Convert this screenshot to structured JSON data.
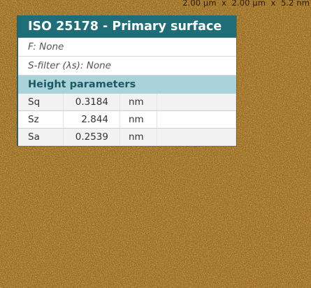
{
  "image": {
    "dimensions_label": "2.00 µm  x  2.00 µm  x  5.2 nm"
  },
  "panel": {
    "title": "ISO 25178 - Primary surface",
    "filter_f": "F: None",
    "filter_s": "S-filter (λs): None",
    "section_title": "Height parameters",
    "rows": [
      {
        "name": "Sq",
        "value": "0.3184",
        "unit": "nm"
      },
      {
        "name": "Sz",
        "value": "2.844",
        "unit": "nm"
      },
      {
        "name": "Sa",
        "value": "0.2539",
        "unit": "nm"
      }
    ]
  },
  "colors": {
    "title_bg": "#1f6d76",
    "section_bg": "#a9d3d8",
    "surface_dark": "#5e3a08",
    "surface_light": "#d9a94a"
  }
}
